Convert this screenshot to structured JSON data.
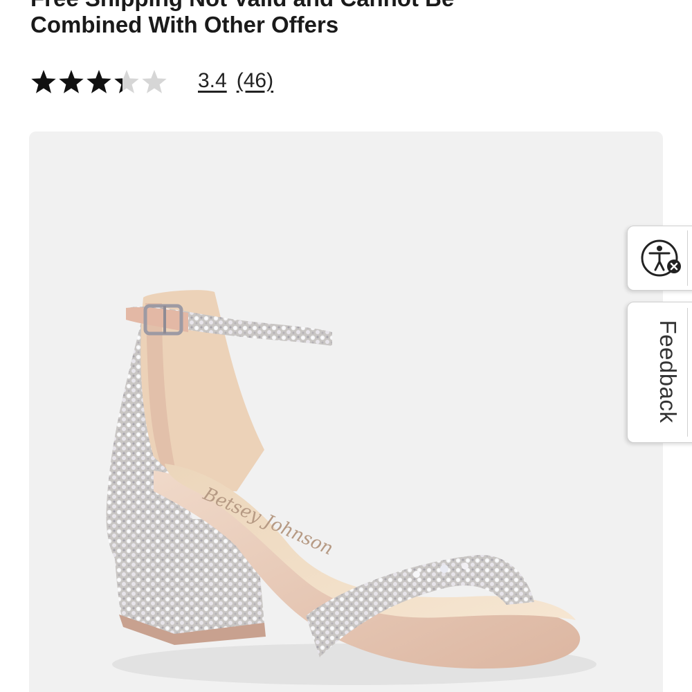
{
  "product": {
    "title_partial": "Free Shipping Not Valid and Cannot Be",
    "title_line2": "Combined With Other Offers",
    "rating": {
      "stars": 3.4,
      "max_stars": 5,
      "value": "3.4",
      "count": "(46)"
    },
    "image": {
      "subject": "sandal-image",
      "insole_signature": "Betsey Johnson"
    }
  },
  "side_tabs": {
    "accessibility_icon": "accessibility-icon",
    "feedback_label": "Feedback"
  },
  "colors": {
    "star_filled": "#111111",
    "star_empty": "#d6d6d6",
    "image_background": "#f1f1f1",
    "sandal_satin": "#e9c9b6"
  }
}
